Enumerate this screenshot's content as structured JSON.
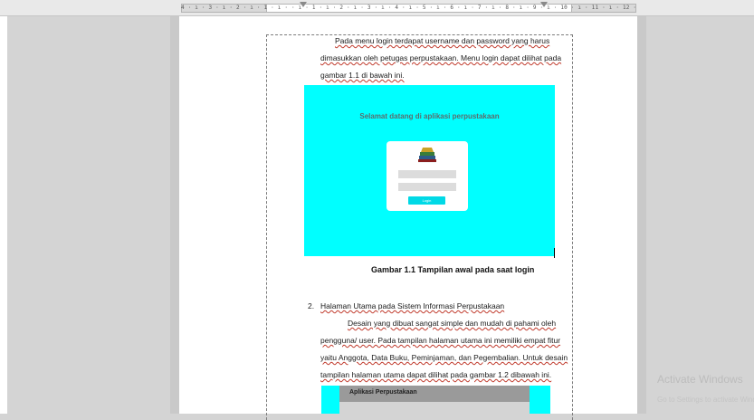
{
  "ruler": {
    "ticks": "4 · ı · 3 · ı · 2 · ı · 1 · ı ·   · ı · 1 · ı · 2 · ı · 3 · ı · 4 · ı · 5 · ı · 6 · ı · 7 · ı · 8 · ı · 9 · ı · 10 · ı · 11 · ı · 12 · ı · 13 · ı ·   · ı · 15 · ı · 16 · ı ·"
  },
  "document": {
    "para1_line1": "Pada menu login terdapat username dan password yang harus",
    "para1_line2": "dimasukkan oleh petugas perpustakaan. Menu login dapat dilihat pada",
    "para1_line3": "gambar 1.1 di bawah ini.",
    "figure1": {
      "title": "Selamat datang di aplikasi perpustakaan",
      "button": "Login"
    },
    "caption1": "Gambar 1.1 Tampilan awal pada saat login",
    "list_number": "2.",
    "list_item": "Halaman Utama pada Sistem Informasi Perpustakaan",
    "para2_line1": "Desain yang dibuat sangat simple dan mudah di pahami oleh",
    "para2_line2": "pengguna/ user. Pada tampilan halaman utama ini memiliki empat fitur",
    "para2_line3": "yaitu Anggota, Data Buku, Peminjaman, dan Pegembalian. Untuk desain",
    "para2_line4": "tampilan halaman utama dapat dilihat pada gambar 1.2 dibawah ini.",
    "figure2": {
      "title": "Aplikasi Perpustakaan"
    }
  },
  "watermark": {
    "title": "Activate Windows",
    "subtitle": "Go to Settings to activate Windows."
  }
}
